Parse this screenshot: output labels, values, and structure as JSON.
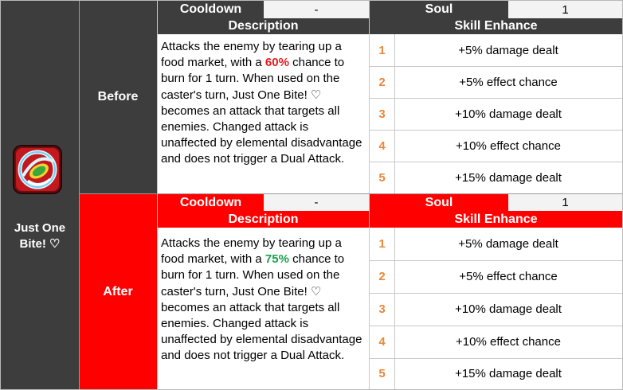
{
  "skill": {
    "name": "Just One Bite! ♡"
  },
  "before": {
    "phase_label": "Before",
    "cooldown_label": "Cooldown",
    "cooldown_value": "-",
    "soul_label": "Soul",
    "soul_value": "1",
    "description_label": "Description",
    "enhance_label": "Skill Enhance",
    "desc_pre": "Attacks the enemy by tearing up a food market, with a ",
    "desc_pct": "60%",
    "desc_post": " chance to burn for 1 turn. When used on the caster's turn, Just One Bite! ♡ becomes an attack that targets all enemies. Changed attack is unaffected by elemental disadvantage and does not trigger a Dual Attack.",
    "enhancements": [
      {
        "num": "1",
        "text": "+5% damage dealt"
      },
      {
        "num": "2",
        "text": "+5% effect chance"
      },
      {
        "num": "3",
        "text": "+10% damage dealt"
      },
      {
        "num": "4",
        "text": "+10% effect chance"
      },
      {
        "num": "5",
        "text": "+15% damage dealt"
      }
    ]
  },
  "after": {
    "phase_label": "After",
    "cooldown_label": "Cooldown",
    "cooldown_value": "-",
    "soul_label": "Soul",
    "soul_value": "1",
    "description_label": "Description",
    "enhance_label": "Skill Enhance",
    "desc_pre": "Attacks the enemy by tearing up a food market, with a ",
    "desc_pct": "75%",
    "desc_post": " chance to burn for 1 turn. When used on the caster's turn, Just One Bite! ♡ becomes an attack that targets all enemies. Changed attack is unaffected by elemental disadvantage and does not trigger a Dual Attack.",
    "enhancements": [
      {
        "num": "1",
        "text": "+5% damage dealt"
      },
      {
        "num": "2",
        "text": "+5% effect chance"
      },
      {
        "num": "3",
        "text": "+10% damage dealt"
      },
      {
        "num": "4",
        "text": "+10% effect chance"
      },
      {
        "num": "5",
        "text": "+15% damage dealt"
      }
    ]
  },
  "colors": {
    "dark": "#3d3d3d",
    "red": "#ff0000",
    "before_pct": "#e8191f",
    "after_pct": "#1aa24a",
    "enhance_number": "#e8883b"
  },
  "icons": {
    "skill": "skill-icon"
  }
}
